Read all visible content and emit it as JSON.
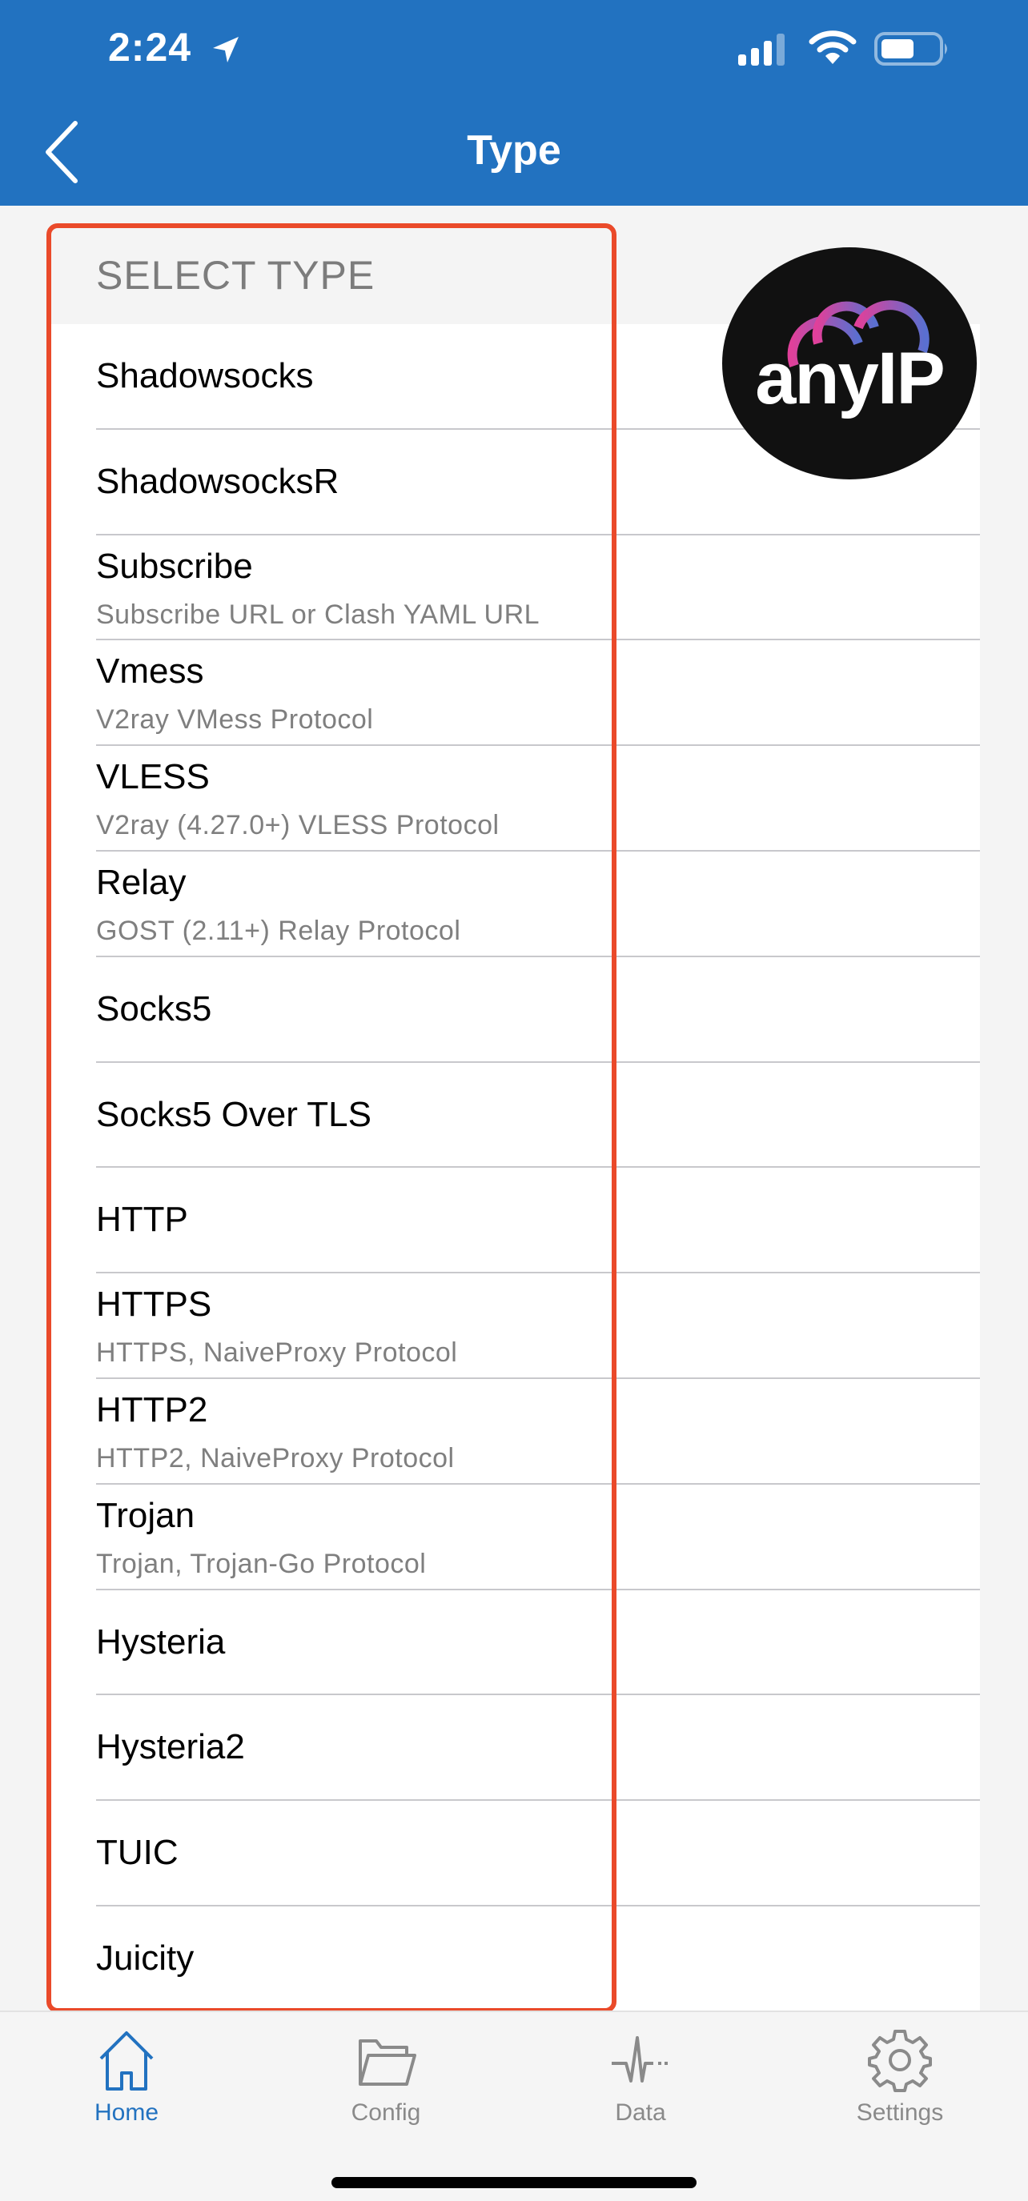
{
  "status_bar": {
    "time": "2:24",
    "icons": [
      "location-arrow-icon",
      "cellular-signal-icon",
      "wifi-icon",
      "battery-icon"
    ]
  },
  "nav": {
    "title": "Type",
    "back_icon": "chevron-left-icon"
  },
  "section": {
    "header": "SELECT TYPE"
  },
  "types": [
    {
      "label": "Shadowsocks",
      "sub": ""
    },
    {
      "label": "ShadowsocksR",
      "sub": ""
    },
    {
      "label": "Subscribe",
      "sub": "Subscribe URL or Clash YAML URL"
    },
    {
      "label": "Vmess",
      "sub": "V2ray VMess Protocol"
    },
    {
      "label": "VLESS",
      "sub": "V2ray (4.27.0+) VLESS Protocol"
    },
    {
      "label": "Relay",
      "sub": "GOST (2.11+) Relay Protocol"
    },
    {
      "label": "Socks5",
      "sub": ""
    },
    {
      "label": "Socks5 Over TLS",
      "sub": ""
    },
    {
      "label": "HTTP",
      "sub": ""
    },
    {
      "label": "HTTPS",
      "sub": "HTTPS, NaiveProxy Protocol"
    },
    {
      "label": "HTTP2",
      "sub": "HTTP2, NaiveProxy Protocol"
    },
    {
      "label": "Trojan",
      "sub": "Trojan, Trojan-Go Protocol"
    },
    {
      "label": "Hysteria",
      "sub": ""
    },
    {
      "label": "Hysteria2",
      "sub": ""
    },
    {
      "label": "TUIC",
      "sub": ""
    },
    {
      "label": "Juicity",
      "sub": ""
    }
  ],
  "logo": {
    "text": "anyIP"
  },
  "tabs": [
    {
      "label": "Home",
      "icon": "home-icon",
      "active": true
    },
    {
      "label": "Config",
      "icon": "folder-icon",
      "active": false
    },
    {
      "label": "Data",
      "icon": "pulse-icon",
      "active": false
    },
    {
      "label": "Settings",
      "icon": "gear-icon",
      "active": false
    }
  ],
  "colors": {
    "brand": "#2272c0",
    "highlight": "#ea4a2a",
    "active_tab": "#2272c0",
    "inactive_tab": "#8a8a8a"
  }
}
